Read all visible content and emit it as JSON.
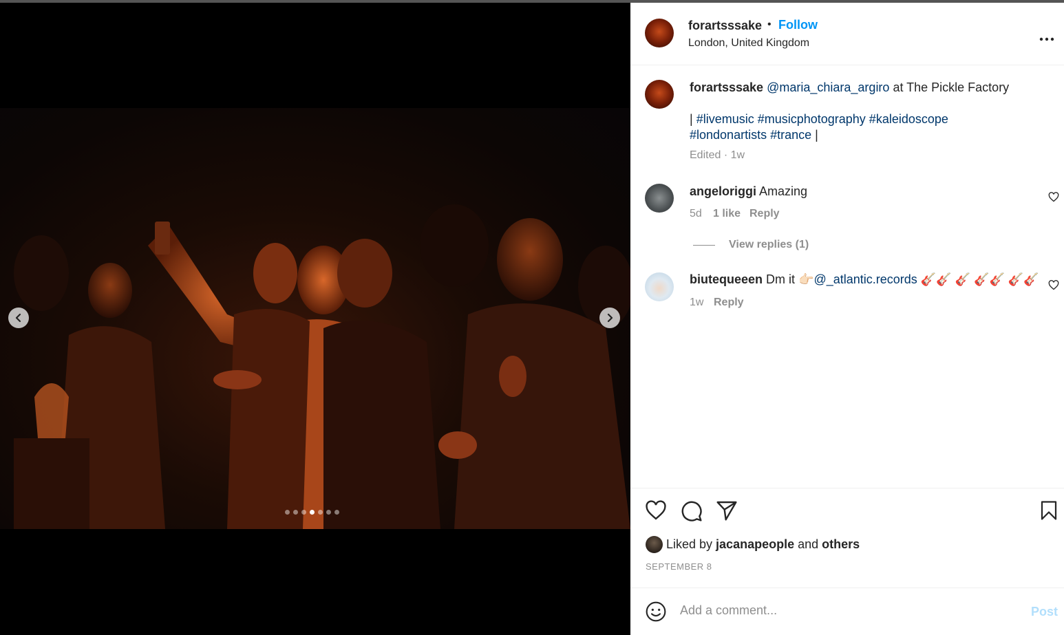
{
  "media": {
    "slides_total": 7,
    "active_slide": 4,
    "prev_icon": "chevron-left-icon",
    "next_icon": "chevron-right-icon"
  },
  "header": {
    "username": "forartsssake",
    "separator": "•",
    "follow_label": "Follow",
    "location": "London, United Kingdom",
    "more_icon": "more-horizontal-icon",
    "more_label": "···"
  },
  "caption": {
    "username": "forartsssake",
    "mention": "@maria_chiara_argiro",
    "text_after_mention": " at The Pickle Factory",
    "line2_prefix": "| ",
    "hashtags_line1": "#livemusic #musicphotography #kaleidoscope",
    "hashtags_line2": "#londonartists #trance",
    "line3_suffix": " |",
    "meta": "Edited · 1w"
  },
  "comments": [
    {
      "username": "angeloriggi",
      "text": "Amazing",
      "time": "5d",
      "likes": "1 like",
      "reply_label": "Reply",
      "view_replies": "View replies (1)"
    },
    {
      "username": "biutequeeen",
      "text_prefix": "Dm it 👉🏻",
      "mention": "@_atlantic.records",
      "text_suffix": " 🎸🎸 🎸 🎸🎸 🎸🎸",
      "time": "1w",
      "reply_label": "Reply"
    }
  ],
  "actions": {
    "like_icon": "heart-icon",
    "comment_icon": "comment-icon",
    "share_icon": "send-icon",
    "save_icon": "bookmark-icon"
  },
  "likes": {
    "prefix": "Liked by ",
    "user": "jacanapeople",
    "middle": " and ",
    "others": "others"
  },
  "post_date": "SEPTEMBER 8",
  "comment_box": {
    "emoji_icon": "emoji-icon",
    "placeholder": "Add a comment...",
    "post_label": "Post"
  },
  "colors": {
    "link": "#00376b",
    "follow": "#0095f6",
    "muted": "#8e8e8e",
    "post_disabled": "#b2dffc"
  }
}
